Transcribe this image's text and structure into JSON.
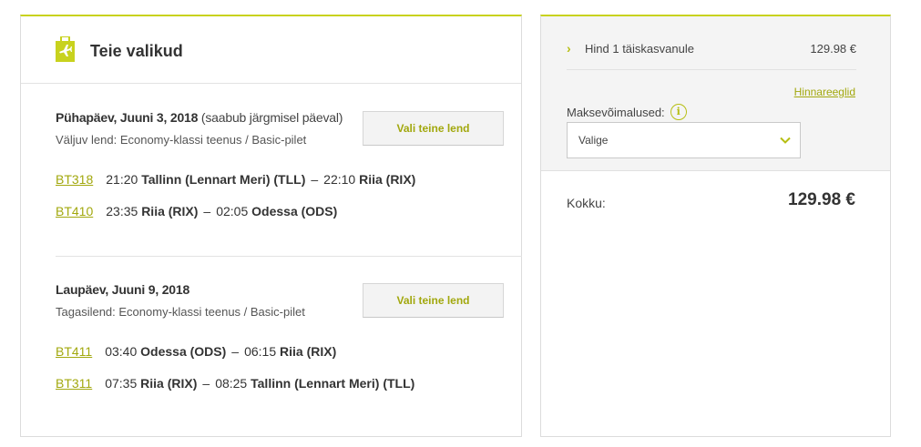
{
  "selections": {
    "title": "Teie valikud",
    "icon": "suitcase-plane-icon",
    "accent_color": "#c8d21e"
  },
  "outbound": {
    "date": "Pühapäev, Juuni 3, 2018",
    "date_note": "(saabub järgmisel päeval)",
    "subtitle": "Väljuv lend: Economy-klassi teenus / Basic-pilet",
    "change_button": "Vali teine lend",
    "segments": [
      {
        "flight": "BT318",
        "dep_time": "21:20",
        "dep_airport": "Tallinn (Lennart Meri) (TLL)",
        "dash": "–",
        "arr_time": "22:10",
        "arr_airport": "Riia (RIX)"
      },
      {
        "flight": "BT410",
        "dep_time": "23:35",
        "dep_airport": "Riia (RIX)",
        "dash": "–",
        "arr_time": "02:05",
        "arr_airport": "Odessa (ODS)"
      }
    ]
  },
  "inbound": {
    "date": "Laupäev, Juuni 9, 2018",
    "subtitle": "Tagasilend: Economy-klassi teenus / Basic-pilet",
    "change_button": "Vali teine lend",
    "segments": [
      {
        "flight": "BT411",
        "dep_time": "03:40",
        "dep_airport": "Odessa (ODS)",
        "dash": "–",
        "arr_time": "06:15",
        "arr_airport": "Riia (RIX)"
      },
      {
        "flight": "BT311",
        "dep_time": "07:35",
        "dep_airport": "Riia (RIX)",
        "dash": "–",
        "arr_time": "08:25",
        "arr_airport": "Tallinn (Lennart Meri) (TLL)"
      }
    ]
  },
  "summary": {
    "price_label": "Hind 1 täiskasvanule",
    "price_value": "129.98 €",
    "rules_link": "Hinnareeglid",
    "payment_label": "Maksevõimalused:",
    "payment_selected": "Valige",
    "total_label": "Kokku:",
    "total_value": "129.98 €"
  }
}
